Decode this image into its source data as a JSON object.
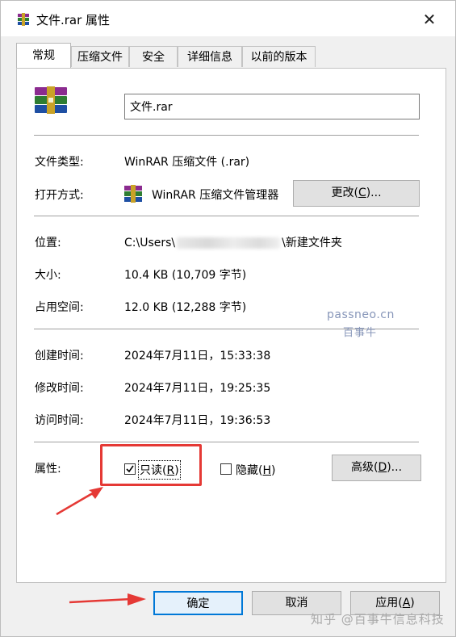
{
  "window": {
    "title": "文件.rar 属性",
    "close_glyph": "✕"
  },
  "tabs": [
    {
      "label": "常规"
    },
    {
      "label": "压缩文件"
    },
    {
      "label": "安全"
    },
    {
      "label": "详细信息"
    },
    {
      "label": "以前的版本"
    }
  ],
  "general": {
    "file_name": "文件.rar",
    "type_label": "文件类型:",
    "type_value": "WinRAR 压缩文件 (.rar)",
    "open_with_label": "打开方式:",
    "open_with_value": "WinRAR 压缩文件管理器",
    "change_button": {
      "text": "更改(",
      "key": "C",
      "suffix": ")..."
    },
    "location_label": "位置:",
    "location_prefix": "C:\\Users\\",
    "location_suffix": "\\新建文件夹",
    "size_label": "大小:",
    "size_value": "10.4 KB (10,709 字节)",
    "disk_size_label": "占用空间:",
    "disk_size_value": "12.0 KB (12,288 字节)",
    "created_label": "创建时间:",
    "created_value": "2024年7月11日，15:33:38",
    "modified_label": "修改时间:",
    "modified_value": "2024年7月11日，19:25:35",
    "accessed_label": "访问时间:",
    "accessed_value": "2024年7月11日，19:36:53",
    "attributes_label": "属性:",
    "readonly": {
      "text": "只读(",
      "key": "R",
      "suffix": ")",
      "checked": true
    },
    "hidden": {
      "text": "隐藏(",
      "key": "H",
      "suffix": ")",
      "checked": false
    },
    "advanced_button": {
      "text": "高级(",
      "key": "D",
      "suffix": ")..."
    }
  },
  "watermark": {
    "line1": "passneo.cn",
    "line2": "百事牛"
  },
  "footer": {
    "ok_label": "确定",
    "cancel_label": "取消",
    "apply": {
      "text": "应用(",
      "key": "A",
      "suffix": ")"
    },
    "watermark": "知乎 @百事牛信息科技"
  },
  "colors": {
    "annotation_red": "#e53935",
    "accent_blue": "#0078d7"
  }
}
